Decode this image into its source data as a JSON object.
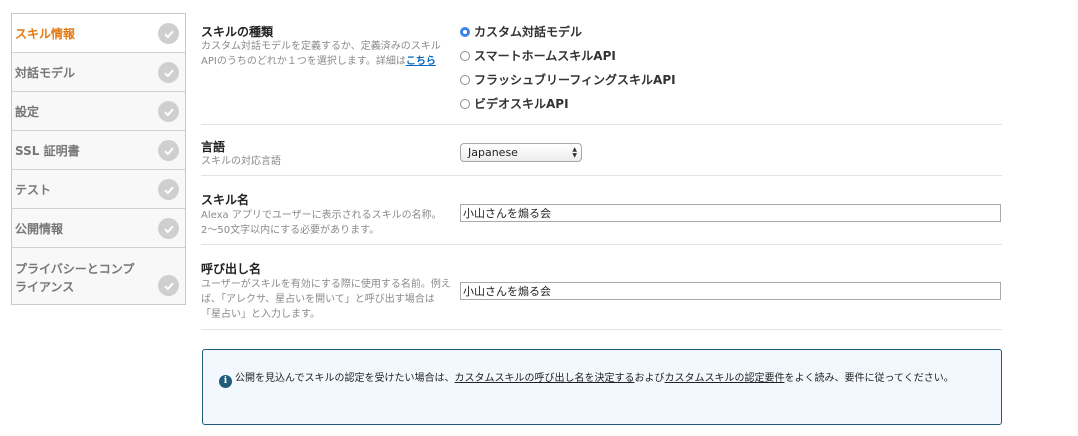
{
  "sidebar": {
    "items": [
      {
        "label": "スキル情報"
      },
      {
        "label": "対話モデル"
      },
      {
        "label": "設定"
      },
      {
        "label": "SSL 証明書"
      },
      {
        "label": "テスト"
      },
      {
        "label": "公開情報"
      },
      {
        "label": "プライバシーとコンプライアンス"
      }
    ]
  },
  "skill_type": {
    "label": "スキルの種類",
    "desc_text": "カスタム対話モデルを定義するか、定義済みのスキルAPIのうちのどれか１つを選択します。詳細は",
    "desc_link": "こちら",
    "options": [
      {
        "label": "カスタム対話モデル"
      },
      {
        "label": "スマートホームスキルAPI"
      },
      {
        "label": "フラッシュブリーフィングスキルAPI"
      },
      {
        "label": "ビデオスキルAPI"
      }
    ]
  },
  "language": {
    "label": "言語",
    "desc": "スキルの対応言語",
    "selected": "Japanese"
  },
  "skill_name": {
    "label": "スキル名",
    "desc": "Alexa アプリでユーザーに表示されるスキルの名称。2〜50文字以内にする必要があります。",
    "value": "小山さんを煽る会"
  },
  "invocation": {
    "label": "呼び出し名",
    "desc": "ユーザーがスキルを有効にする際に使用する名前。例えば、「アレクサ、星占いを開いて」と呼び出す場合は「星占い」と入力します。",
    "value": "小山さんを煽る会"
  },
  "info": {
    "text1": "公開を見込んでスキルの認定を受けたい場合は、",
    "link1": "カスタムスキルの呼び出し名を決定する",
    "text2": "および",
    "link2": "カスタムスキルの認定要件",
    "text3": "をよく読み、要件に従ってください。"
  }
}
